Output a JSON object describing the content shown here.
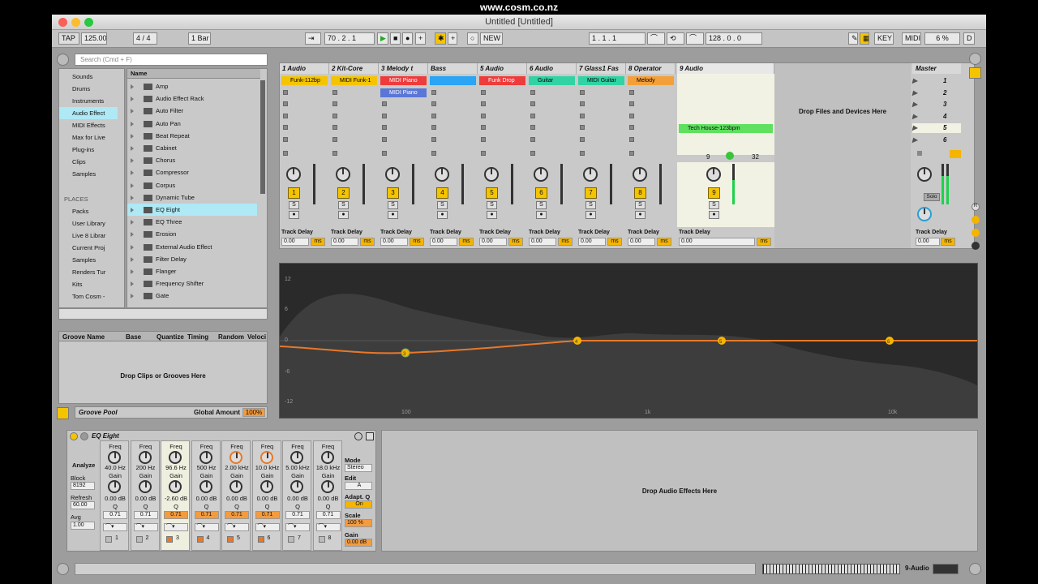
{
  "site": "www.cosm.co.nz",
  "window_title": "Untitled  [Untitled]",
  "control_bar": {
    "tap": "TAP",
    "tempo": "125.00",
    "sig": "4 / 4",
    "quant": "1 Bar",
    "position": "70 .  2 .  1",
    "new": "NEW",
    "loop_start": "1 .  1 .  1",
    "loop_len": "128 .  0 .  0",
    "key": "KEY",
    "midi": "MIDI",
    "cpu": "6 %",
    "d": "D"
  },
  "browser": {
    "search_placeholder": "Search (Cmd + F)",
    "categories": [
      "Sounds",
      "Drums",
      "Instruments",
      "Audio Effect",
      "MIDI Effects",
      "Max for Live",
      "Plug-ins",
      "Clips",
      "Samples"
    ],
    "places_title": "PLACES",
    "places": [
      "Packs",
      "User Library",
      "Live 8 Librar",
      "Current Proj",
      "Samples",
      "Renders Tur",
      "Kits",
      "Tom Cosm -"
    ],
    "name_header": "Name",
    "items": [
      "Amp",
      "Audio Effect Rack",
      "Auto Filter",
      "Auto Pan",
      "Beat Repeat",
      "Cabinet",
      "Chorus",
      "Compressor",
      "Corpus",
      "Dynamic Tube",
      "EQ Eight",
      "EQ Three",
      "Erosion",
      "External Audio Effect",
      "Filter Delay",
      "Flanger",
      "Frequency Shifter",
      "Gate"
    ]
  },
  "groove": {
    "headers": [
      "Groove Name",
      "Base",
      "Quantize",
      "Timing",
      "Random",
      "Veloci"
    ],
    "drop": "Drop Clips or Grooves Here",
    "pool": "Groove Pool",
    "global_label": "Global Amount",
    "global_value": "100%"
  },
  "session": {
    "tracks": [
      {
        "name": "1 Audio",
        "clip": "Funk-112bp",
        "color": "#f5c400",
        "num": "1"
      },
      {
        "name": "2 Kit-Core",
        "clip": "MIDI Funk-1",
        "color": "#f5c400",
        "num": "2"
      },
      {
        "name": "3 Melody t",
        "clip": "MIDI Piano",
        "clip2": "MIDI Piano",
        "color": "#ee3b3b",
        "num": "3"
      },
      {
        "name": "Bass",
        "clip": "",
        "color": "#2aa4f4",
        "num": "4"
      },
      {
        "name": "5 Audio",
        "clip": "Funk Drop",
        "color": "#ee3b3b",
        "num": "5"
      },
      {
        "name": "6 Audio",
        "clip": "Guitar",
        "color": "#31d3a4",
        "num": "6"
      },
      {
        "name": "7 Glass1 Fas",
        "clip": "MIDI Guitar",
        "color": "#31d3a4",
        "num": "7"
      },
      {
        "name": "8 Operator",
        "clip": "Melody",
        "color": "#f3a03a",
        "num": "8"
      }
    ],
    "audio9": {
      "name": "9 Audio",
      "clip": "Tech House-123bpm",
      "num": "9",
      "in": "9",
      "out": "32"
    },
    "drop": "Drop Files and Devices Here",
    "master": "Master",
    "scenes": [
      "1",
      "2",
      "3",
      "4",
      "5",
      "6"
    ],
    "track_delay": "Track Delay",
    "delay_val": "0.00",
    "ms": "ms",
    "solo": "Solo"
  },
  "eq_display": {
    "y_labels": [
      "12",
      "6",
      "0",
      "-6",
      "-12"
    ],
    "x_labels": [
      "100",
      "1k",
      "10k"
    ]
  },
  "device": {
    "title": "EQ Eight",
    "analyze": "Analyze",
    "block_label": "Block",
    "block": "8192",
    "refresh_label": "Refresh",
    "refresh": "60.00",
    "avg_label": "Avg",
    "avg": "1.00",
    "freq_label": "Freq",
    "gain_label": "Gain",
    "q_label": "Q",
    "bands": [
      {
        "f": "40.0 Hz",
        "g": "0.00 dB",
        "q": "0.71",
        "n": "1"
      },
      {
        "f": "200 Hz",
        "g": "0.00 dB",
        "q": "0.71",
        "n": "2"
      },
      {
        "f": "96.6 Hz",
        "g": "-2.60 dB",
        "q": "0.71",
        "n": "3"
      },
      {
        "f": "500 Hz",
        "g": "0.00 dB",
        "q": "0.71",
        "n": "4"
      },
      {
        "f": "2.00 kHz",
        "g": "0.00 dB",
        "q": "0.71",
        "n": "5"
      },
      {
        "f": "10.0 kHz",
        "g": "0.00 dB",
        "q": "0.71",
        "n": "6"
      },
      {
        "f": "5.00 kHz",
        "g": "0.00 dB",
        "q": "0.71",
        "n": "7"
      },
      {
        "f": "18.0 kHz",
        "g": "0.00 dB",
        "q": "0.71",
        "n": "8"
      }
    ],
    "mode_label": "Mode",
    "mode": "Stereo",
    "edit_label": "Edit",
    "edit": "A",
    "adapt_label": "Adapt. Q",
    "adapt": "On",
    "scale_label": "Scale",
    "scale": "100 %",
    "gain2_label": "Gain",
    "gain2": "0.00 dB",
    "drop": "Drop Audio Effects Here"
  },
  "status": {
    "track": "9-Audio"
  }
}
